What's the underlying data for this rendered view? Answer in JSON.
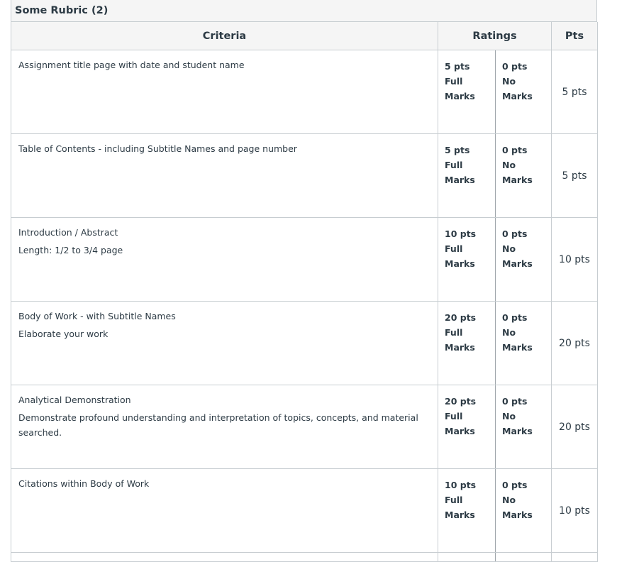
{
  "rubric": {
    "title": "Some Rubric (2)",
    "headers": {
      "criteria": "Criteria",
      "ratings": "Ratings",
      "pts": "Pts"
    },
    "rows": [
      {
        "description": "Assignment title page with date and student name",
        "long_description": "",
        "rating1_pts": "5 pts",
        "rating1_l1": "Full",
        "rating1_l2": "Marks",
        "rating2_pts": "0 pts",
        "rating2_l1": "No",
        "rating2_l2": "Marks",
        "points": "5 pts"
      },
      {
        "description": "Table of Contents - including Subtitle Names and page number",
        "long_description": "",
        "rating1_pts": "5 pts",
        "rating1_l1": "Full",
        "rating1_l2": "Marks",
        "rating2_pts": "0 pts",
        "rating2_l1": "No",
        "rating2_l2": "Marks",
        "points": "5 pts"
      },
      {
        "description": "Introduction / Abstract",
        "long_description": "Length: 1/2 to 3/4 page",
        "rating1_pts": "10 pts",
        "rating1_l1": "Full",
        "rating1_l2": "Marks",
        "rating2_pts": "0 pts",
        "rating2_l1": "No",
        "rating2_l2": "Marks",
        "points": "10 pts"
      },
      {
        "description": "Body of Work - with Subtitle Names",
        "long_description": "Elaborate your work",
        "rating1_pts": "20 pts",
        "rating1_l1": "Full",
        "rating1_l2": "Marks",
        "rating2_pts": "0 pts",
        "rating2_l1": "No",
        "rating2_l2": "Marks",
        "points": "20 pts"
      },
      {
        "description": "Analytical Demonstration",
        "long_description": "Demonstrate profound understanding and interpretation of topics, concepts, and material searched.",
        "rating1_pts": "20 pts",
        "rating1_l1": "Full",
        "rating1_l2": "Marks",
        "rating2_pts": "0 pts",
        "rating2_l1": "No",
        "rating2_l2": "Marks",
        "points": "20 pts"
      },
      {
        "description": "Citations within Body of Work",
        "long_description": "",
        "rating1_pts": "10 pts",
        "rating1_l1": "Full",
        "rating1_l2": "Marks",
        "rating2_pts": "0 pts",
        "rating2_l1": "No",
        "rating2_l2": "Marks",
        "points": "10 pts"
      }
    ]
  }
}
